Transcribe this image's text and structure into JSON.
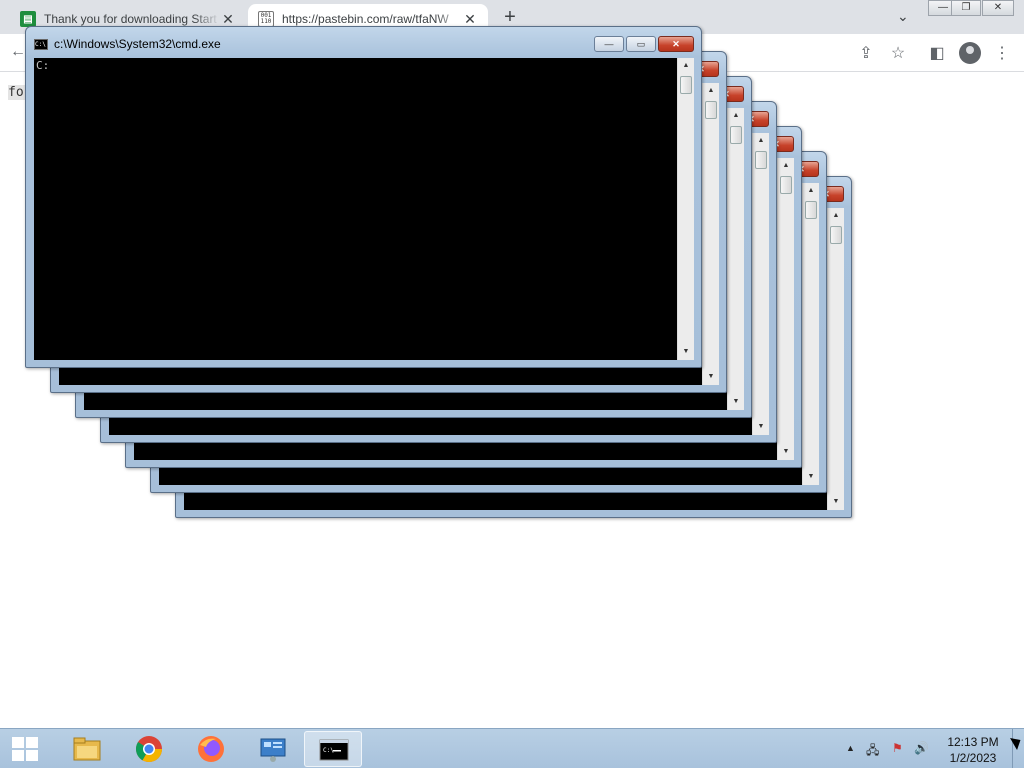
{
  "browser": {
    "tabs": [
      {
        "title": "Thank you for downloading Start",
        "favicon": "sheet-icon",
        "close": "✕"
      },
      {
        "title": "https://pastebin.com/raw/tfaNW",
        "favicon": "bin-icon",
        "close": "✕"
      }
    ],
    "new_tab": "+",
    "tab_search": "⌄",
    "window_controls": {
      "minimize": "—",
      "restore": "❐",
      "close": "✕"
    },
    "toolbar": {
      "back": "←",
      "share": "⇪",
      "bookmark": "☆",
      "sidepanel": "◧",
      "menu": "⋮"
    },
    "page_text": "for"
  },
  "cmd": {
    "title": "c:\\Windows\\System32\\cmd.exe",
    "icon_text": "C:\\",
    "prompt": "C:",
    "controls": {
      "minimize": "—",
      "maximize": "▭",
      "close": "✕"
    },
    "scroll_up": "▲",
    "scroll_down": "▼",
    "window_count": 7
  },
  "taskbar": {
    "apps": [
      {
        "name": "file-explorer",
        "active": false
      },
      {
        "name": "chrome",
        "active": false
      },
      {
        "name": "firefox",
        "active": false
      },
      {
        "name": "control-panel",
        "active": false
      },
      {
        "name": "command-prompt",
        "active": true
      }
    ],
    "tray": {
      "arrow": "▲",
      "network": "🖧",
      "flag": "⚑",
      "volume": "🔊"
    },
    "clock": {
      "time": "12:13 PM",
      "date": "1/2/2023"
    }
  },
  "colors": {
    "taskbar": "#b8cfe4",
    "console": "#000000",
    "close_button": "#c7422a"
  }
}
